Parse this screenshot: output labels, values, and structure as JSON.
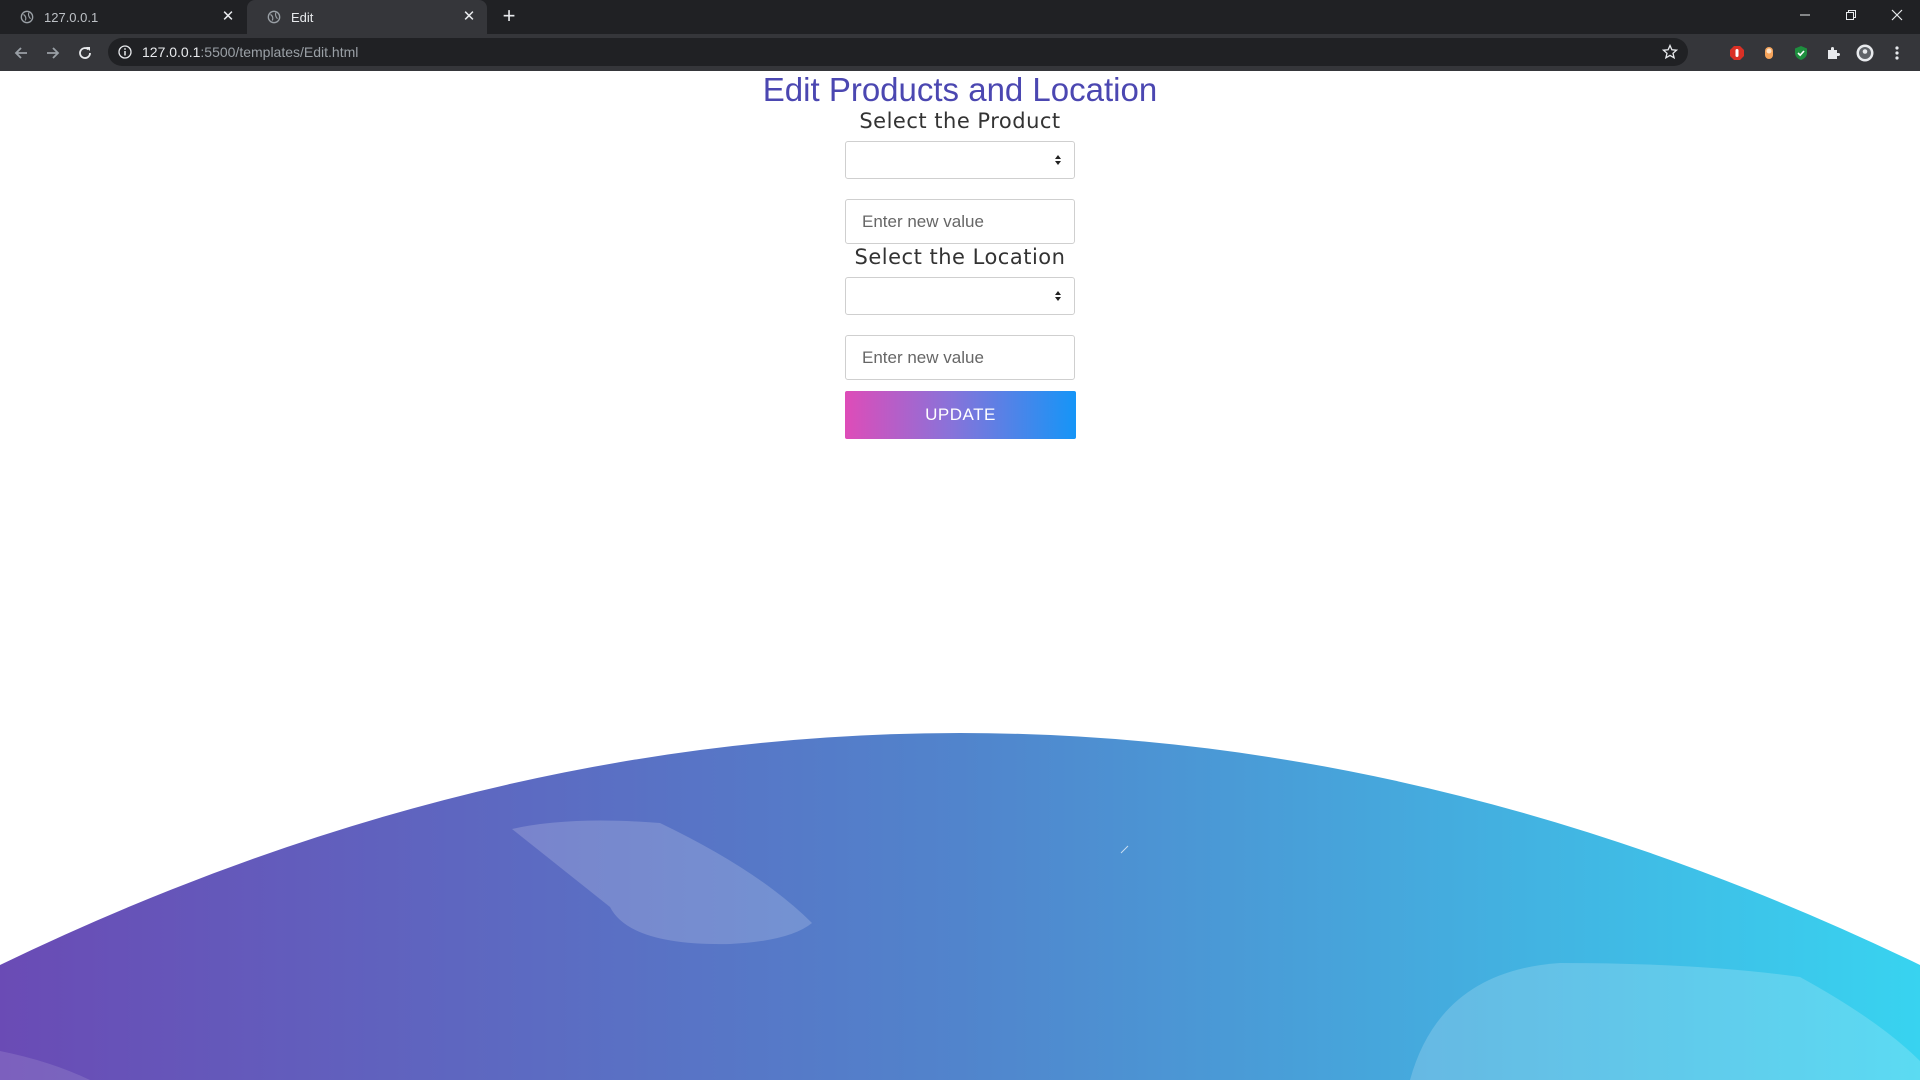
{
  "browser": {
    "tabs": [
      {
        "title": "127.0.0.1",
        "active": false
      },
      {
        "title": "Edit",
        "active": true
      }
    ],
    "url_host": "127.0.0.1",
    "url_rest": ":5500/templates/Edit.html"
  },
  "page": {
    "title": "Edit Products and Location",
    "product": {
      "label": "Select the Product",
      "select_value": "",
      "input_placeholder": "Enter new value"
    },
    "location": {
      "label": "Select the Location",
      "select_value": "",
      "input_placeholder": "Enter new value"
    },
    "update_button": "UPDATE"
  },
  "colors": {
    "title": "#4b47b1",
    "button_gradient_start": "#de4cb8",
    "button_gradient_end": "#1595f7",
    "wave_start": "#6a4bb5",
    "wave_end": "#38d3f0"
  }
}
